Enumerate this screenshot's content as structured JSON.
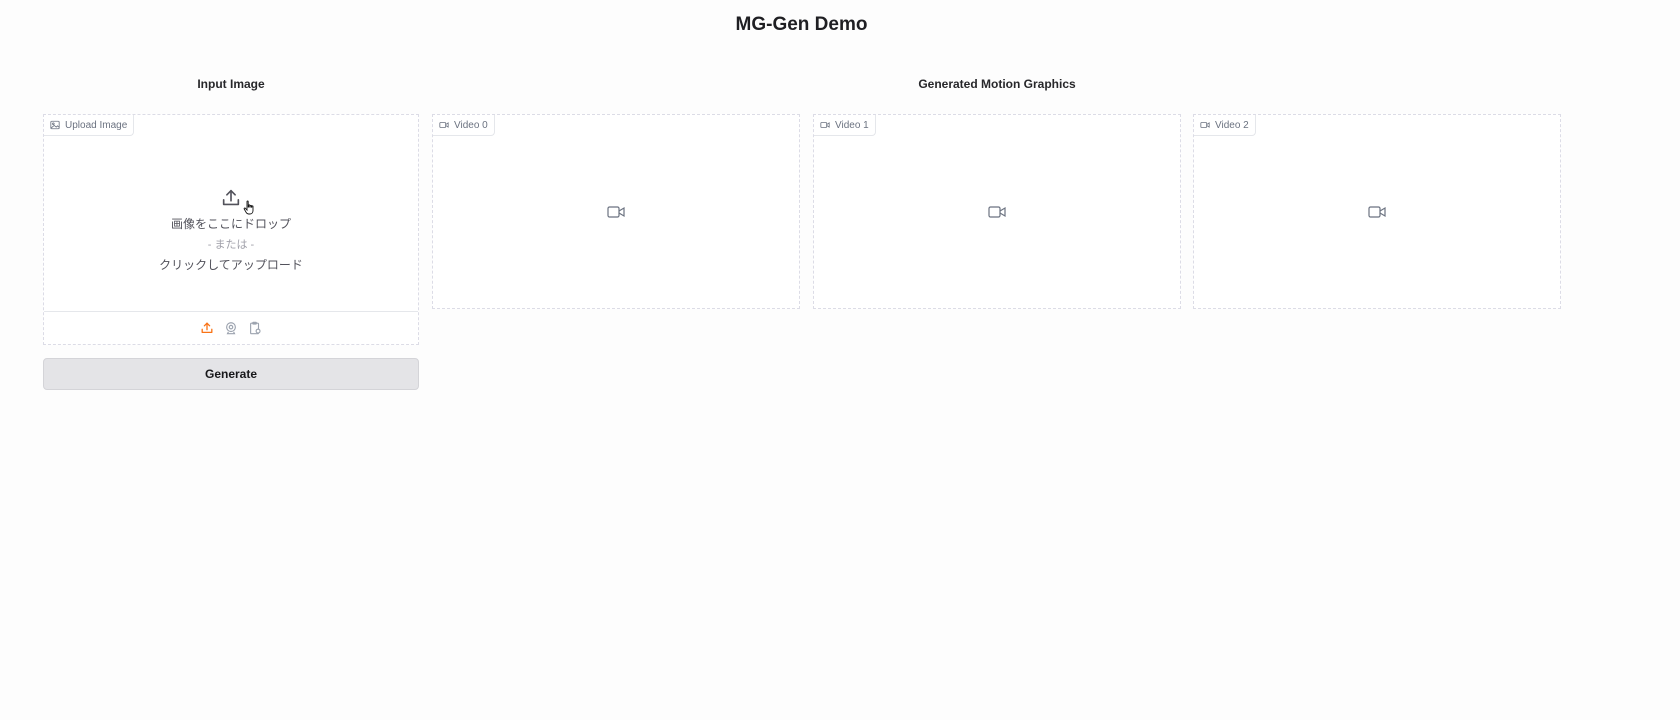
{
  "app": {
    "title": "MG-Gen Demo"
  },
  "input_section": {
    "heading": "Input Image",
    "tag_label": "Upload Image",
    "drop_text": "画像をここにドロップ",
    "or_text": "- または -",
    "click_text": "クリックしてアップロード",
    "sources": [
      {
        "name": "upload",
        "icon": "upload-icon",
        "active": true
      },
      {
        "name": "webcam",
        "icon": "webcam-icon",
        "active": false
      },
      {
        "name": "clipboard",
        "icon": "clipboard-icon",
        "active": false
      }
    ]
  },
  "generate_button": {
    "label": "Generate"
  },
  "output_section": {
    "heading": "Generated Motion Graphics",
    "videos": [
      {
        "label": "Video 0"
      },
      {
        "label": "Video 1"
      },
      {
        "label": "Video 2"
      }
    ]
  },
  "colors": {
    "accent": "#f97316",
    "icon_gray": "#6b7280",
    "button_bg": "#e4e4e7"
  }
}
